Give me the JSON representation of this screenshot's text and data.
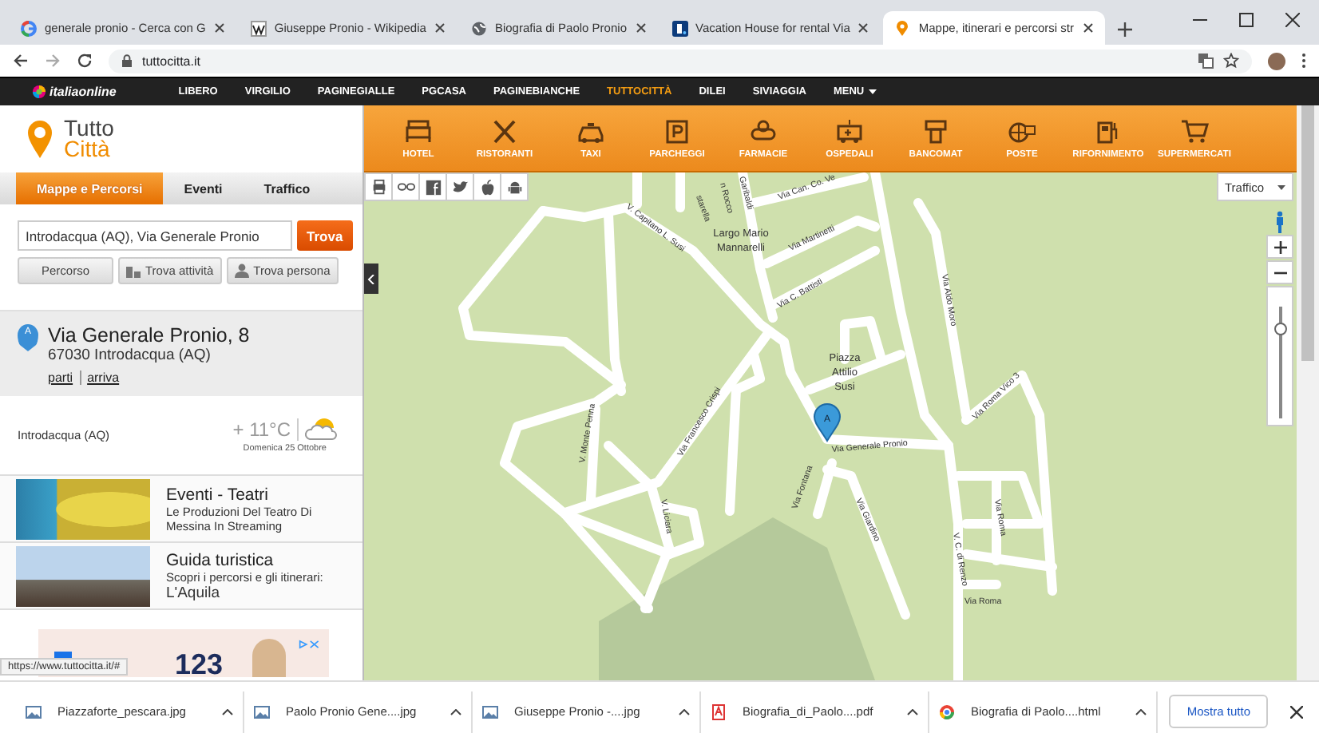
{
  "browser": {
    "tabs": [
      {
        "title": "generale pronio - Cerca con G",
        "kind": "google",
        "selected": false
      },
      {
        "title": "Giuseppe Pronio - Wikipedia",
        "kind": "wiki",
        "selected": false
      },
      {
        "title": "Biografia di Paolo Pronio",
        "kind": "globe",
        "selected": false
      },
      {
        "title": "Vacation House for rental Via",
        "kind": "booking",
        "selected": false
      },
      {
        "title": "Mappe, itinerari e percorsi str",
        "kind": "pin",
        "selected": true
      }
    ],
    "url": "tuttocitta.it"
  },
  "site_nav": {
    "logo": "italiaonline",
    "items": [
      {
        "label": "LIBERO",
        "selected": false
      },
      {
        "label": "VIRGILIO",
        "selected": false
      },
      {
        "label": "PAGINEGIALLE",
        "selected": false
      },
      {
        "label": "PGCASA",
        "selected": false
      },
      {
        "label": "PAGINEBIANCHE",
        "selected": false
      },
      {
        "label": "TUTTOCITTÀ",
        "selected": true
      },
      {
        "label": "DILEI",
        "selected": false
      },
      {
        "label": "SIVIAGGIA",
        "selected": false
      },
      {
        "label": "MENU",
        "selected": false,
        "kind": "menu"
      }
    ]
  },
  "sidebar": {
    "logo": {
      "line1": "Tutto",
      "line2": "Città"
    },
    "tabs": [
      {
        "label": "Mappe e Percorsi",
        "selected": true
      },
      {
        "label": "Eventi",
        "selected": false
      },
      {
        "label": "Traffico",
        "selected": false
      }
    ],
    "search": {
      "value": "Introdacqua (AQ), Via Generale Pronio",
      "button": "Trova"
    },
    "actions": [
      {
        "label": "Percorso",
        "kind": "plain"
      },
      {
        "label": "Trova attività",
        "kind": "business"
      },
      {
        "label": "Trova persona",
        "kind": "person"
      }
    ],
    "address": {
      "pin": "A",
      "title": "Via Generale Pronio, 8",
      "line": "67030 Introdacqua (AQ)",
      "links": [
        "parti",
        "arriva"
      ]
    },
    "weather": {
      "place": "Introdacqua (AQ)",
      "temperature": "+ 11°C",
      "date": "Domenica 25 Ottobre"
    },
    "cards": [
      {
        "kind": "mask",
        "title": "Eventi - Teatri",
        "text": "Le Produzioni Del Teatro Di Messina In Streaming"
      },
      {
        "kind": "church",
        "title": "Guida turistica",
        "text": "Scopri i percorsi e gli itinerari:",
        "subtitle": "L'Aquila"
      }
    ],
    "ad": {
      "text": "123"
    },
    "status_url": "https://www.tuttocitta.it/#"
  },
  "categories": [
    {
      "label": "HOTEL",
      "kind": "bed"
    },
    {
      "label": "RISTORANTI",
      "kind": "cutlery"
    },
    {
      "label": "TAXI",
      "kind": "taxi"
    },
    {
      "label": "PARCHEGGI",
      "kind": "parking"
    },
    {
      "label": "FARMACIE",
      "kind": "pill"
    },
    {
      "label": "OSPEDALI",
      "kind": "ambulance"
    },
    {
      "label": "BANCOMAT",
      "kind": "atm"
    },
    {
      "label": "POSTE",
      "kind": "mail"
    },
    {
      "label": "RIFORNIMENTO",
      "kind": "fuel"
    },
    {
      "label": "SUPERMERCATI",
      "kind": "cart"
    }
  ],
  "map": {
    "traffic_select": "Traffico",
    "pin": "A",
    "zoom_slider": {
      "level": 0.8
    },
    "labels": [
      "starella",
      "n Rocco",
      "Garibaldi",
      "V. Capitano L. Susi",
      "Via Can. Co. Ve",
      "Largo Mario",
      "Mannarelli",
      "Via Martinetti",
      "Via C. Battisti",
      "Piazza",
      "Attilio",
      "Susi",
      "Via Aldo Moro",
      "Via Francesco Crispi",
      "Via Generale Pronio",
      "Via Roma Vico 3",
      "V. Monte Penna",
      "Via Fontana",
      "Via Giardino",
      "V. Liciara",
      "Via Roma",
      "V. C. di Renzo",
      "Via Roma"
    ]
  },
  "downloads": {
    "items": [
      {
        "name": "Piazzaforte_pescara.jpg",
        "kind": "image"
      },
      {
        "name": "Paolo Pronio Gene....jpg",
        "kind": "image"
      },
      {
        "name": "Giuseppe Pronio -....jpg",
        "kind": "image"
      },
      {
        "name": "Biografia_di_Paolo....pdf",
        "kind": "pdf"
      },
      {
        "name": "Biografia di Paolo....html",
        "kind": "web"
      }
    ],
    "show_all": "Mostra tutto"
  }
}
